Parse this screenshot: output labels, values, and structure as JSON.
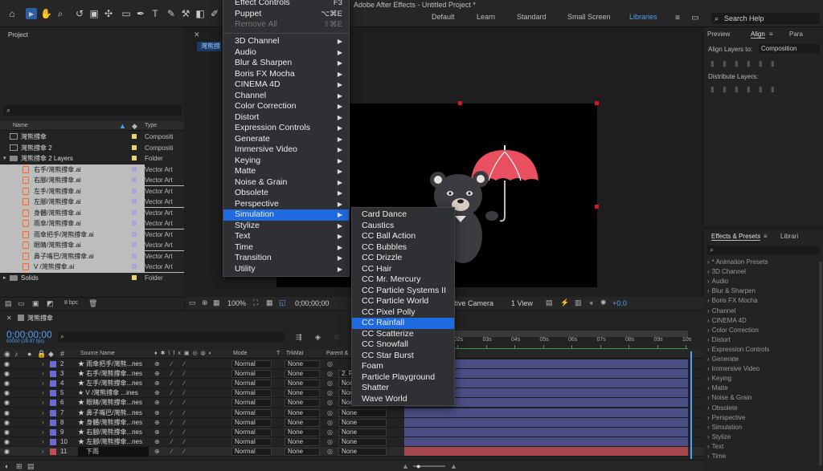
{
  "app": {
    "window_title": "Adobe After Effects - Untitled Project *"
  },
  "workspaces": [
    "Default",
    "Learn",
    "Standard",
    "Small Screen",
    "Libraries"
  ],
  "search_help": "Search Help",
  "project_panel": {
    "title": "Project",
    "columns": {
      "name": "Name",
      "type": "Type"
    },
    "items": [
      {
        "name": "灣熊撐傘",
        "type": "Compositi",
        "kind": "comp",
        "label_color": "#e9d36a",
        "indent": 0,
        "selected": false
      },
      {
        "name": "灣熊撐傘 2",
        "type": "Compositi",
        "kind": "comp",
        "label_color": "#e9d36a",
        "indent": 0,
        "selected": false
      },
      {
        "name": "灣熊撐傘 2 Layers",
        "type": "Folder",
        "kind": "folder",
        "label_color": "#e9d36a",
        "indent": 0,
        "selected": false
      },
      {
        "name": "右手/灣熊撐傘.ai",
        "type": "Vector Art",
        "kind": "ai",
        "label_color": "#a6a6d8",
        "indent": 1,
        "selected": true
      },
      {
        "name": "右腳/灣熊撐傘.ai",
        "type": "Vector Art",
        "kind": "ai",
        "label_color": "#a6a6d8",
        "indent": 1,
        "selected": true
      },
      {
        "name": "左手/灣熊撐傘.ai",
        "type": "Vector Art",
        "kind": "ai",
        "label_color": "#a6a6d8",
        "indent": 1,
        "selected": true
      },
      {
        "name": "左腳/灣熊撐傘.ai",
        "type": "Vector Art",
        "kind": "ai",
        "label_color": "#a6a6d8",
        "indent": 1,
        "selected": true
      },
      {
        "name": "身體/灣熊撐傘.ai",
        "type": "Vector Art",
        "kind": "ai",
        "label_color": "#a6a6d8",
        "indent": 1,
        "selected": true
      },
      {
        "name": "雨傘/灣熊撐傘.ai",
        "type": "Vector Art",
        "kind": "ai",
        "label_color": "#a6a6d8",
        "indent": 1,
        "selected": true
      },
      {
        "name": "雨傘把手/灣熊撐傘.ai",
        "type": "Vector Art",
        "kind": "ai",
        "label_color": "#a6a6d8",
        "indent": 1,
        "selected": true
      },
      {
        "name": "眼睛/灣熊撐傘.ai",
        "type": "Vector Art",
        "kind": "ai",
        "label_color": "#a6a6d8",
        "indent": 1,
        "selected": true
      },
      {
        "name": "鼻子嘴巴/灣熊撐傘.ai",
        "type": "Vector Art",
        "kind": "ai",
        "label_color": "#a6a6d8",
        "indent": 1,
        "selected": true
      },
      {
        "name": "V /灣熊撐傘.ai",
        "type": "Vector Art",
        "kind": "ai",
        "label_color": "#a6a6d8",
        "indent": 1,
        "selected": true
      },
      {
        "name": "Solids",
        "type": "Folder",
        "kind": "folder",
        "label_color": "#e9d36a",
        "indent": 0,
        "selected": false
      }
    ],
    "bpc": "8 bpc"
  },
  "viewer": {
    "tab": "灣熊撐",
    "zoom": "100%",
    "timecode": "0;00;00;00",
    "camera": "ctive Camera",
    "view": "1 View",
    "exposure": "+0.0"
  },
  "right_top": {
    "tabs": [
      "Preview",
      "Align",
      "Para"
    ],
    "align_layers_to_label": "Align Layers to:",
    "align_layers_to_value": "Composition",
    "distribute_label": "Distribute Layers:"
  },
  "effects_panel": {
    "tabs": [
      "Effects & Presets",
      "Librari"
    ],
    "items": [
      "* Animation Presets",
      "3D Channel",
      "Audio",
      "Blur & Sharpen",
      "Boris FX Mocha",
      "Channel",
      "CINEMA 4D",
      "Color Correction",
      "Distort",
      "Expression Controls",
      "Generate",
      "Immersive Video",
      "Keying",
      "Matte",
      "Noise & Grain",
      "Obsolete",
      "Perspective",
      "Simulation",
      "Stylize",
      "Text",
      "Time"
    ]
  },
  "timeline": {
    "comp_name": "灣熊撐傘",
    "timecode": "0;00;00;00",
    "frame_info": "00000 (29.97 fps)",
    "headers": {
      "source": "Source Name",
      "mode": "Mode",
      "t": "T",
      "trkmat": "TrkMat",
      "parent": "Parent &"
    },
    "ruler": [
      "02s",
      "03s",
      "04s",
      "05s",
      "06s",
      "07s",
      "08s",
      "09s",
      "10s"
    ],
    "layers": [
      {
        "num": "2",
        "name": "★ 雨傘把手/灣熊...nes",
        "mode": "Normal",
        "trk": "None",
        "parent": "",
        "color": "#6a6ad0"
      },
      {
        "num": "3",
        "name": "★ 右手/灣熊撐傘...nes",
        "mode": "Normal",
        "trk": "None",
        "parent": "2. F",
        "color": "#6a6ad0"
      },
      {
        "num": "4",
        "name": "★ 左手/灣熊撐傘...nes",
        "mode": "Normal",
        "trk": "None",
        "parent": "None",
        "color": "#6a6ad0"
      },
      {
        "num": "5",
        "name": "★ V /灣熊撐傘 ...ines",
        "mode": "Normal",
        "trk": "None",
        "parent": "None",
        "color": "#6a6ad0"
      },
      {
        "num": "6",
        "name": "★ 眼睛/灣熊撐傘...nes",
        "mode": "Normal",
        "trk": "None",
        "parent": "None",
        "color": "#6a6ad0"
      },
      {
        "num": "7",
        "name": "★ 鼻子嘴巴/灣熊...nes",
        "mode": "Normal",
        "trk": "None",
        "parent": "None",
        "color": "#6a6ad0"
      },
      {
        "num": "8",
        "name": "★ 身體/灣熊撐傘...nes",
        "mode": "Normal",
        "trk": "None",
        "parent": "None",
        "color": "#6a6ad0"
      },
      {
        "num": "9",
        "name": "★ 右腳/灣熊撐傘...nes",
        "mode": "Normal",
        "trk": "None",
        "parent": "None",
        "color": "#6a6ad0"
      },
      {
        "num": "10",
        "name": "★ 左腳/灣熊撐傘...nes",
        "mode": "Normal",
        "trk": "None",
        "parent": "None",
        "color": "#6a6ad0"
      },
      {
        "num": "11",
        "name": "下雨",
        "mode": "Normal",
        "trk": "None",
        "parent": "None",
        "color": "#c94c4c"
      }
    ]
  },
  "effect_menu": {
    "top_items": [
      {
        "label": "Effect Controls",
        "shortcut": "F3",
        "disabled": false
      },
      {
        "label": "Puppet",
        "shortcut": "⌥⌘E",
        "disabled": false
      },
      {
        "label": "Remove All",
        "shortcut": "⇧⌘E",
        "disabled": true
      }
    ],
    "categories": [
      "3D Channel",
      "Audio",
      "Blur & Sharpen",
      "Boris FX Mocha",
      "CINEMA 4D",
      "Channel",
      "Color Correction",
      "Distort",
      "Expression Controls",
      "Generate",
      "Immersive Video",
      "Keying",
      "Matte",
      "Noise & Grain",
      "Obsolete",
      "Perspective",
      "Simulation",
      "Stylize",
      "Text",
      "Time",
      "Transition",
      "Utility"
    ],
    "highlighted": "Simulation"
  },
  "simulation_menu": {
    "items": [
      "Card Dance",
      "Caustics",
      "CC Ball Action",
      "CC Bubbles",
      "CC Drizzle",
      "CC Hair",
      "CC Mr. Mercury",
      "CC Particle Systems II",
      "CC Particle World",
      "CC Pixel Polly",
      "CC Rainfall",
      "CC Scatterize",
      "CC Snowfall",
      "CC Star Burst",
      "Foam",
      "Particle Playground",
      "Shatter",
      "Wave World"
    ],
    "highlighted": "CC Rainfall"
  },
  "colors": {
    "accent": "#1f6ae0",
    "ai_icon": "#ff6a1a",
    "umbrella": "#e8505f"
  }
}
